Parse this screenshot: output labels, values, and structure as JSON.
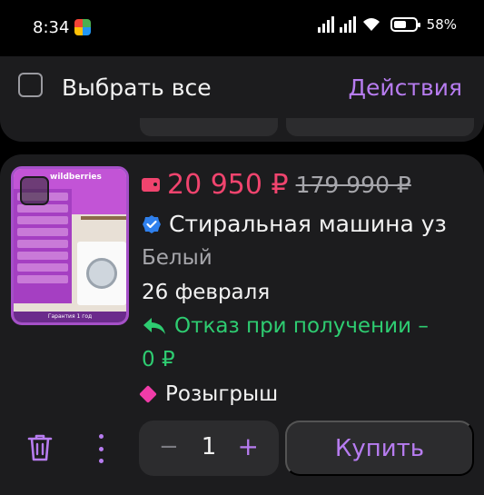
{
  "status_bar": {
    "time": "8:34",
    "battery_percent": "58%",
    "battery_level": 0.58
  },
  "header": {
    "select_all_label": "Выбрать все",
    "actions_label": "Действия"
  },
  "product": {
    "price": "20 950 ₽",
    "old_price": "179 990 ₽",
    "title": "Стиральная машина уз",
    "color": "Белый",
    "delivery_date": "26 февраля",
    "return_policy_line1": "Отказ при получении –",
    "return_policy_line2": "0 ₽",
    "promo": "Розыгрыш",
    "image_brand": "wildberries",
    "image_footer": "Гарантия 1 год"
  },
  "cart_controls": {
    "minus": "−",
    "quantity": "1",
    "plus": "+",
    "buy_label": "Купить"
  },
  "colors": {
    "accent": "#b77cf0",
    "price": "#f0446e",
    "success": "#2ecc71",
    "verified": "#2f80ed",
    "promo_tag": "#f03ca8"
  },
  "icons": {
    "select": "checkbox-icon",
    "wallet": "wallet-icon",
    "verified": "verified-check-icon",
    "return": "return-arrow-icon",
    "promo": "tag-icon",
    "delete": "trash-icon",
    "more": "more-vertical-icon"
  }
}
